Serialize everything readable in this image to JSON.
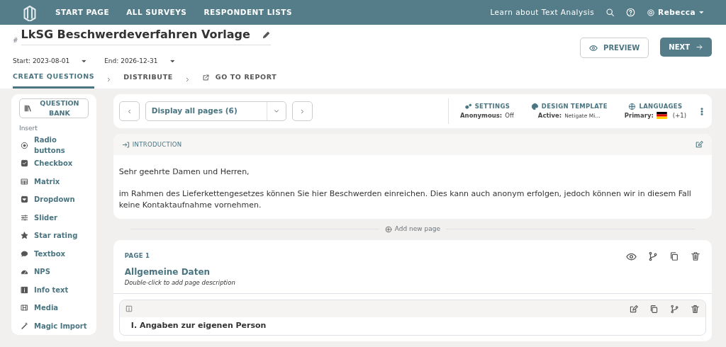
{
  "nav": {
    "links": [
      "START PAGE",
      "ALL SURVEYS",
      "RESPONDENT LISTS"
    ],
    "learn": "Learn about Text Analysis",
    "user": "Rebecca"
  },
  "survey": {
    "hash": "#",
    "title": "LkSG Beschwerdeverfahren Vorlage",
    "start": "Start: 2023-08-01",
    "end": "End: 2026-12-31"
  },
  "actions": {
    "preview": "PREVIEW",
    "next": "NEXT"
  },
  "steps": [
    {
      "label": "CREATE QUESTIONS",
      "selected": true
    },
    {
      "label": "DISTRIBUTE",
      "selected": false
    },
    {
      "label": "GO TO REPORT",
      "selected": false
    }
  ],
  "sidebar": {
    "bank": "QUESTION BANK",
    "insert": "Insert",
    "items": [
      "Radio buttons",
      "Checkbox",
      "Matrix",
      "Dropdown",
      "Slider",
      "Star rating",
      "Textbox",
      "NPS",
      "Info text",
      "Media",
      "Magic Import"
    ]
  },
  "toolbar": {
    "page_select": "Display all pages (6)",
    "settings": {
      "title": "SETTINGS",
      "label": "Anonymous:",
      "value": "Off"
    },
    "design": {
      "title": "DESIGN TEMPLATE",
      "label": "Active:",
      "value": "Netigate Mi…"
    },
    "languages": {
      "title": "LANGUAGES",
      "label": "Primary:",
      "extra": "(+1)"
    }
  },
  "intro": {
    "title": "INTRODUCTION",
    "paragraphs": [
      "Sehr geehrte Damen und Herren,",
      "im Rahmen des Lieferkettengesetzes können Sie hier Beschwerden einreichen. Dies kann auch anonym erfolgen, jedoch können wir in diesem Fall keine Kontaktaufnahme vornehmen."
    ]
  },
  "add_page": "Add new page",
  "page": {
    "number": "PAGE 1",
    "title": "Allgemeine Daten",
    "description": "Double-click to add page description",
    "question": {
      "title": "I. Angaben zur eigenen Person"
    }
  }
}
